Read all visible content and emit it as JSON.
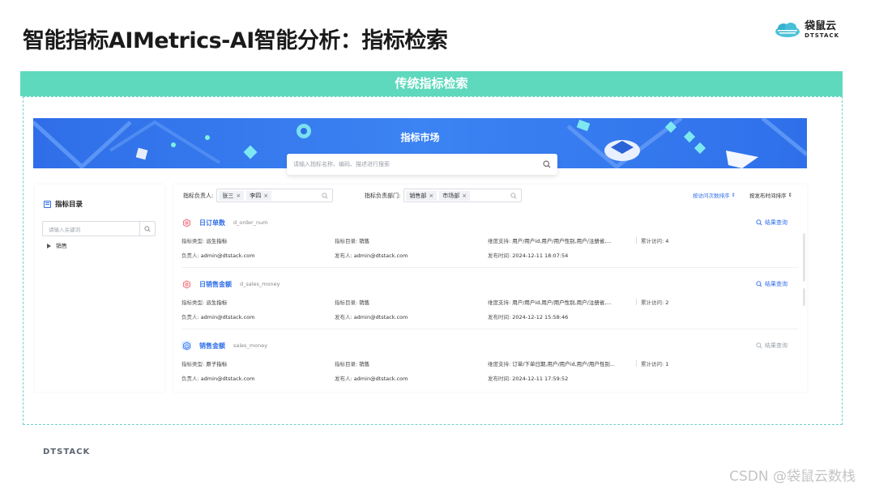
{
  "slide": {
    "title": "智能指标AIMetrics-AI智能分析：指标检索",
    "logo_cn": "袋鼠云",
    "logo_en": "DTSTACK",
    "banner": "传统指标检索",
    "footer": "DTSTACK",
    "watermark": "CSDN @袋鼠云数栈"
  },
  "colors": {
    "accent": "#2f6ee8",
    "banner": "#5fd9bd",
    "dashed": "#6cd3c9"
  },
  "market": {
    "title": "指标市场",
    "search_placeholder": "请输入指标名称、编码、描述进行搜索"
  },
  "sidebar": {
    "title": "指标目录",
    "search_placeholder": "请输入关键词",
    "tree": [
      {
        "label": "销售",
        "expand_icon": "chevron-right-icon"
      }
    ]
  },
  "filters": {
    "owner_label": "指标负责人:",
    "owner_tags": [
      "张三",
      "李四"
    ],
    "dept_label": "指标负责部门:",
    "dept_tags": [
      "销售部",
      "市场部"
    ],
    "sort_by_visits": "按访问次数排序",
    "sort_by_publish": "按发布时间排序"
  },
  "labels": {
    "type": "指标类型:",
    "catalog": "指标目录:",
    "dims": "维度支持:",
    "visits": "累计访问:",
    "owner": "负责人:",
    "publisher": "发布人:",
    "publish_time": "发布时间:",
    "result_query": "结果查询"
  },
  "metrics": [
    {
      "name": "日订单数",
      "code": "d_order_num",
      "type": "派生指标",
      "catalog": "销售",
      "dims": "用户/用户id,用户/用户性别,用户/注册省,...",
      "visits": "4",
      "owner": "admin@dtstack.com",
      "publisher": "admin@dtstack.com",
      "publish_time": "2024-12-11 18:07:54",
      "icon": "derived-metric-icon",
      "query_enabled": true
    },
    {
      "name": "日销售金额",
      "code": "d_sales_money",
      "type": "派生指标",
      "catalog": "销售",
      "dims": "用户/用户id,用户/用户性别,用户/注册省,...",
      "visits": "2",
      "owner": "admin@dtstack.com",
      "publisher": "admin@dtstack.com",
      "publish_time": "2024-12-12 15:58:46",
      "icon": "derived-metric-icon",
      "query_enabled": true
    },
    {
      "name": "销售金额",
      "code": "sales_money",
      "type": "原子指标",
      "catalog": "销售",
      "dims": "订单/下单日期,用户/用户id,用户/用户性别...",
      "visits": "1",
      "owner": "admin@dtstack.com",
      "publisher": "admin@dtstack.com",
      "publish_time": "2024-12-11 17:59:52",
      "icon": "atomic-metric-icon",
      "query_enabled": false
    }
  ]
}
